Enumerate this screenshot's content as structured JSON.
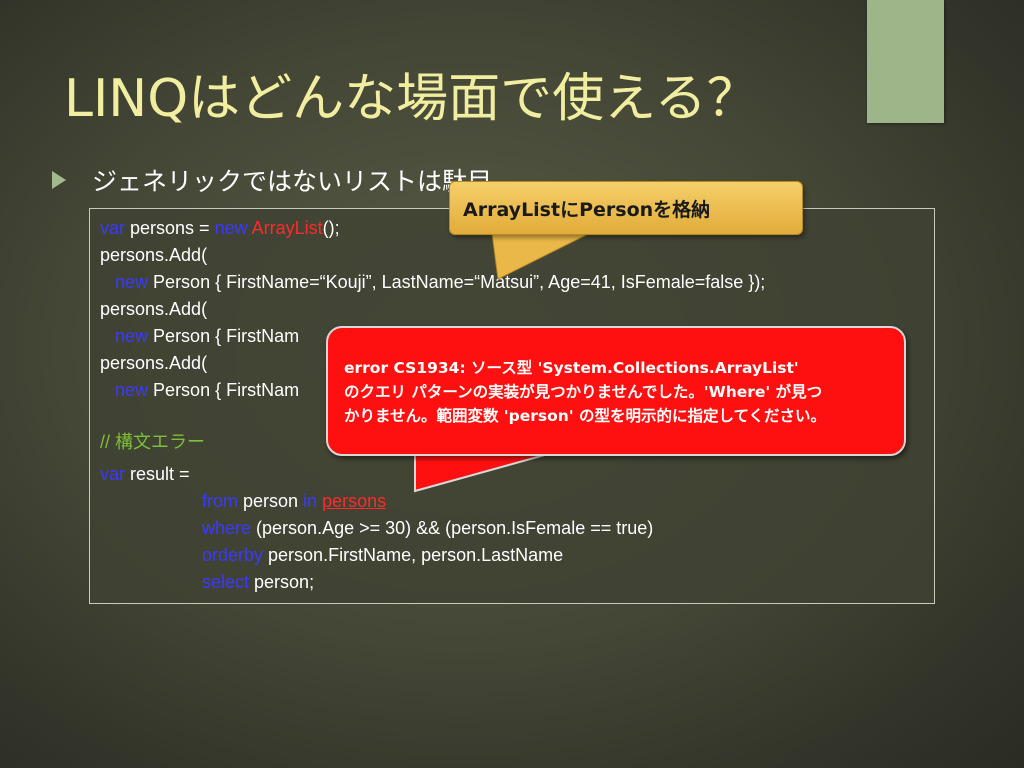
{
  "slide": {
    "title": "LINQはどんな場面で使える？",
    "bullet": "ジェネリックではないリストは駄目"
  },
  "code": {
    "line1": {
      "kw1": "var",
      "t1": " persons = ",
      "kw2": "new",
      "t2": " ",
      "type": "ArrayList",
      "t3": "();"
    },
    "line2": "persons.Add(",
    "line3": {
      "indent": "   ",
      "kw": "new",
      "text": " Person { FirstName=“Kouji”, LastName=“Matsui”, Age=41, IsFemale=false });"
    },
    "line4": "persons.Add(",
    "line5": {
      "indent": "   ",
      "kw": "new",
      "text": " Person { FirstNam"
    },
    "line6": "persons.Add(",
    "line7": {
      "indent": "   ",
      "kw": "new",
      "text": " Person { FirstNam"
    },
    "line8": "// 構文エラー",
    "line9": {
      "kw": "var",
      "text": " result ="
    },
    "line10": {
      "kw1": "from",
      "t1": " person ",
      "kw2": "in",
      "t2": " ",
      "err": "persons"
    },
    "line11": {
      "kw": "where",
      "text": " (person.Age >= 30) && (person.IsFemale == true)"
    },
    "line12": {
      "kw": "orderby",
      "text": " person.FirstName, person.LastName"
    },
    "line13": {
      "kw": "select",
      "text": " person;"
    }
  },
  "callouts": {
    "yellow": "ArrayListにPersonを格納",
    "red": [
      "error CS1934: ソース型 'System.Collections.ArrayList'",
      "のクエリ パターンの実装が見つかりませんでした。'Where' が見つ",
      "かりません。範囲変数 'person' の型を明示的に指定してください。"
    ]
  },
  "colors": {
    "title": "#f2eea0",
    "keyword": "#3a3aff",
    "type": "#ff2a2a",
    "comment": "#7fbf3a",
    "callout_yellow": "#f0c253",
    "callout_red": "#ff1010",
    "accent": "#9eb58a"
  }
}
